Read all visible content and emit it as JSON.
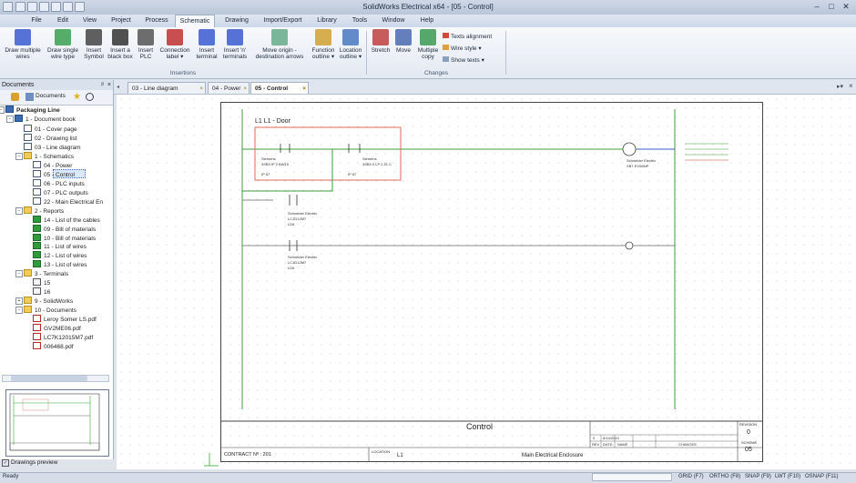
{
  "window": {
    "title": "SolidWorks Electrical x64 - [05 - Control]"
  },
  "menu": {
    "items": [
      "File",
      "Edit",
      "View",
      "Project",
      "Process",
      "Schematic",
      "Drawing",
      "Import/Export",
      "Library",
      "Tools",
      "Window",
      "Help"
    ],
    "active": "Schematic"
  },
  "ribbon": {
    "insertions": {
      "title": "Insertions",
      "buttons": [
        {
          "l1": "Draw multiple",
          "l2": "wires"
        },
        {
          "l1": "Draw single",
          "l2": "wire type"
        },
        {
          "l1": "Insert",
          "l2": "Symbol"
        },
        {
          "l1": "Insert a",
          "l2": "black box"
        },
        {
          "l1": "Insert",
          "l2": "PLC"
        },
        {
          "l1": "Connection",
          "l2": "label ▾"
        },
        {
          "l1": "Insert",
          "l2": "terminal"
        },
        {
          "l1": "Insert 'n'",
          "l2": "terminals"
        },
        {
          "l1": "Move origin -",
          "l2": "destination arrows"
        },
        {
          "l1": "Function",
          "l2": "outline ▾"
        },
        {
          "l1": "Location",
          "l2": "outline ▾"
        }
      ]
    },
    "changes": {
      "title": "Changes",
      "buttons": [
        {
          "l1": "Stretch",
          "l2": ""
        },
        {
          "l1": "Move",
          "l2": ""
        },
        {
          "l1": "Multiple",
          "l2": "copy"
        }
      ],
      "small": [
        "Texts alignment",
        "Wire style ▾",
        "Show texts ▾"
      ]
    }
  },
  "documents": {
    "panel_title": "Documents",
    "tab_label": "Documents",
    "tree": [
      {
        "label": "Packaging Line",
        "bold": true,
        "icon": "book",
        "indent": 0
      },
      {
        "label": "1 - Document book",
        "icon": "book",
        "indent": 1
      },
      {
        "label": "01 - Cover page",
        "icon": "page",
        "indent": 2
      },
      {
        "label": "02 - Drawing list",
        "icon": "page",
        "indent": 2
      },
      {
        "label": "03 - Line diagram",
        "icon": "page",
        "indent": 2
      },
      {
        "label": "1 - Schematics",
        "icon": "folder",
        "indent": 2
      },
      {
        "label": "04 - Power",
        "icon": "page",
        "indent": 3
      },
      {
        "label": "05 - Control",
        "icon": "page",
        "indent": 3
      },
      {
        "label": "06 - PLC inputs",
        "icon": "page",
        "indent": 3
      },
      {
        "label": "07 - PLC outputs",
        "icon": "page",
        "indent": 3
      },
      {
        "label": "22 - Main Electrical En",
        "icon": "page",
        "indent": 3
      },
      {
        "label": "2 - Reports",
        "icon": "folder",
        "indent": 2
      },
      {
        "label": "14 - List of the cables",
        "icon": "rep",
        "indent": 3
      },
      {
        "label": "09 - Bill of materials",
        "icon": "rep",
        "indent": 3
      },
      {
        "label": "10 - Bill of materials",
        "icon": "rep",
        "indent": 3
      },
      {
        "label": "11 - List of wires",
        "icon": "rep",
        "indent": 3
      },
      {
        "label": "12 - List of wires",
        "icon": "rep",
        "indent": 3
      },
      {
        "label": "13 - List of wires",
        "icon": "rep",
        "indent": 3
      },
      {
        "label": "3 - Terminals",
        "icon": "folder",
        "indent": 2
      },
      {
        "label": "15",
        "icon": "term",
        "indent": 3
      },
      {
        "label": "16",
        "icon": "term",
        "indent": 3
      },
      {
        "label": "9 - SolidWorks",
        "icon": "folder",
        "indent": 2
      },
      {
        "label": "10 - Documents",
        "icon": "folder",
        "indent": 2
      },
      {
        "label": "Leroy Somer LS.pdf",
        "icon": "pdf",
        "indent": 3
      },
      {
        "label": "GV2ME06.pdf",
        "icon": "pdf",
        "indent": 3
      },
      {
        "label": "LC7K12015M7.pdf",
        "icon": "pdf",
        "indent": 3
      },
      {
        "label": "006468.pdf",
        "icon": "pdf",
        "indent": 3
      }
    ],
    "preview_label": "Drawings preview"
  },
  "tabs": [
    {
      "label": "03 - Line diagram",
      "active": false
    },
    {
      "label": "04 - Power",
      "active": false
    },
    {
      "label": "05 - Control",
      "active": true
    }
  ],
  "drawing": {
    "header": "L1  L1 - Door",
    "title": "Control",
    "contract": "CONTRACT Nº : 201",
    "location_label": "LOCATION",
    "location_value": "L1",
    "enclosure": "Main Electrical Enclosure",
    "revision_label": "REVISION",
    "revision_value": "0",
    "scheme_label": "SCHEME",
    "scheme_value": "05",
    "rev_cols": [
      "REV",
      "DATE",
      "NAME",
      "CHANGES"
    ],
    "rev_row": [
      "0",
      "6/14/2010",
      "",
      ""
    ],
    "component_texts": {
      "s1_name": "Siemens",
      "s1_ref": "3SB3 IP 2 BW15",
      "s1_ip": "IP 67",
      "s2_name": "Siemens",
      "s2_ref": "3SB3 0 LP 2 51 C",
      "s2_ip": "IP 67",
      "k1_name": "Schneider Electric",
      "k1_ref": "LC1D12M7",
      "k1_code": "LD6",
      "k2_name": "Schneider Electric",
      "k2_ref": "LC1D12M7",
      "k2_code": "LD6",
      "h1_name": "Schneider Electric",
      "h1_ref": "XB7 EV06MP"
    }
  },
  "status": {
    "left": "Ready",
    "items": [
      "GRID (F7)",
      "ORTHO (F8)",
      "SNAP (F9)",
      "LWT (F10)",
      "OSNAP (F11)"
    ]
  }
}
